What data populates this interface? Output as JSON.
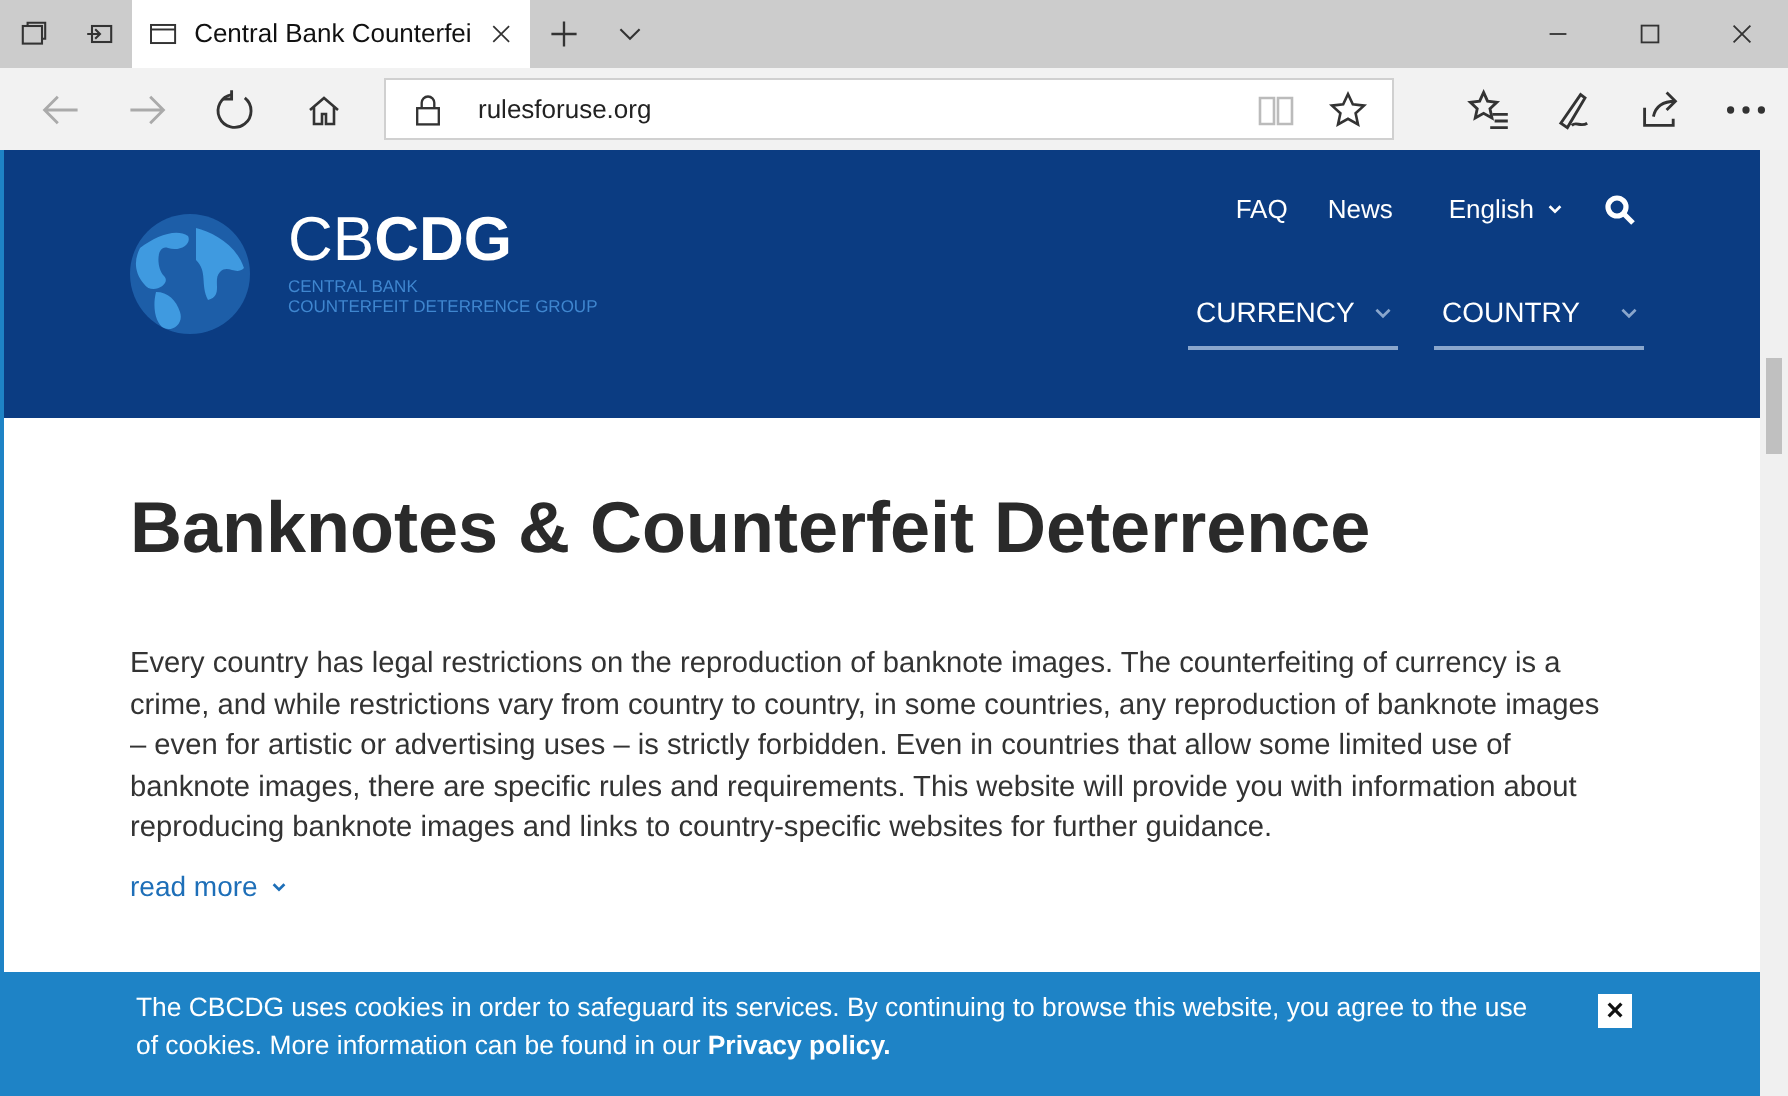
{
  "browser": {
    "tab_title": "Central Bank Counterfei",
    "address": "rulesforuse.org"
  },
  "header": {
    "logo_prefix": "CB",
    "logo_bold": "CDG",
    "logo_sub": [
      "CENTRAL BANK",
      "COUNTERFEIT DETERRENCE GROUP"
    ],
    "top_links": [
      "FAQ",
      "News"
    ],
    "language": "English",
    "menus": [
      {
        "label": "CURRENCY"
      },
      {
        "label": "COUNTRY"
      }
    ]
  },
  "main": {
    "title": "Banknotes & Counterfeit Deterrence",
    "intro": "Every country has legal restrictions on the reproduction of banknote images. The counterfeiting of currency is a crime, and while restrictions vary from country to country, in some countries, any reproduction of banknote images – even for artistic or advertising uses – is strictly forbidden. Even in countries that allow some limited use of banknote images, there are specific rules and requirements. This website will provide you with information about reproducing banknote images and links to country-specific websites for further guidance.",
    "read_more": "read more"
  },
  "cookie_banner": {
    "text": "The CBCDG uses cookies in order to safeguard its services. By continuing to browse this website, you agree to the use of cookies. More information can be found in our **Privacy policy.**",
    "close": "×"
  }
}
